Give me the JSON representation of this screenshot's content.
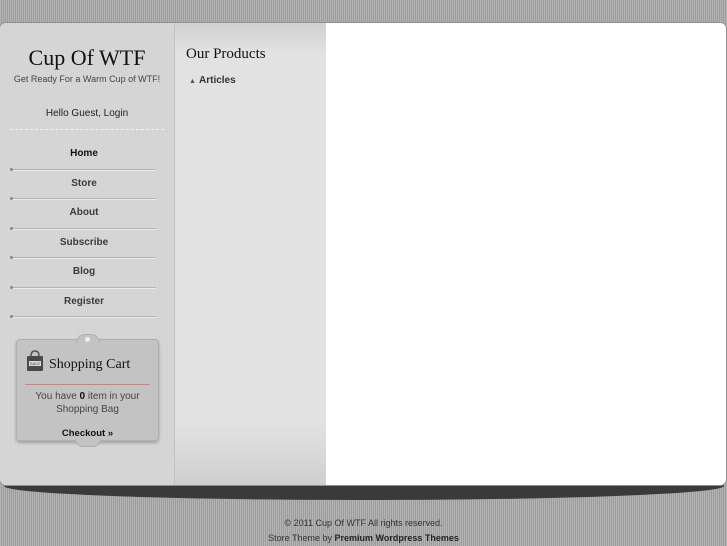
{
  "site": {
    "title": "Cup Of WTF",
    "tagline": "Get Ready For a Warm Cup of WTF!",
    "greeting": "Hello Guest, Login"
  },
  "nav": {
    "items": [
      {
        "label": "Home"
      },
      {
        "label": "Store"
      },
      {
        "label": "About"
      },
      {
        "label": "Subscribe"
      },
      {
        "label": "Blog"
      },
      {
        "label": "Register"
      }
    ]
  },
  "cart": {
    "title": "Shopping Cart",
    "text_before": "You have ",
    "count": "0",
    "text_after": " item in your Shopping Bag",
    "checkout_label": "Checkout »",
    "icon": "shopping-bag-icon"
  },
  "products": {
    "title": "Our Products",
    "links": [
      {
        "label": "Articles"
      }
    ]
  },
  "footer": {
    "copyright": "© 2011 Cup Of WTF All rights reserved.",
    "credit_prefix": "Store Theme by ",
    "credit_link": "Premium Wordpress Themes"
  },
  "colors": {
    "background": "#a9a9a9",
    "sidebar": "#d6d6d6",
    "column": "#e2e2e2",
    "content": "#ffffff"
  }
}
